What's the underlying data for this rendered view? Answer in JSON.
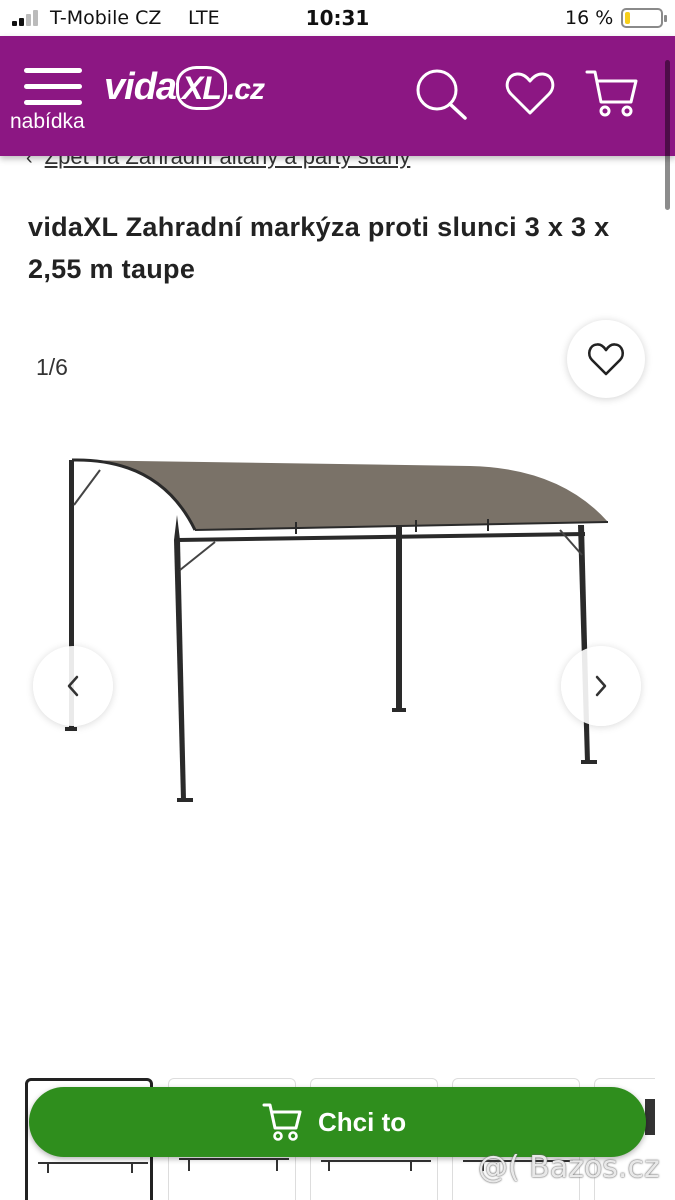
{
  "status_bar": {
    "carrier": "T-Mobile CZ",
    "network": "LTE",
    "time": "10:31",
    "battery_percent": "16 %",
    "battery_level": 0.16,
    "battery_color": "#f7cf1b"
  },
  "header": {
    "background_color": "#8c1783",
    "menu_label": "nabídka",
    "logo": {
      "part1": "vida",
      "part2": "XL",
      "part3": ".cz"
    },
    "icons": [
      "search-icon",
      "heart-icon",
      "cart-icon"
    ]
  },
  "breadcrumb": {
    "back_text": "Zpět na Zahradní altány a party stany"
  },
  "product": {
    "title": "vidaXL Zahradní markýza proti slunci 3 x 3 x 2,55 m taupe",
    "image_counter": "1/6",
    "canopy_color": "#7a7268",
    "thumbnail_count": 5
  },
  "cta": {
    "label": "Chci to",
    "color": "#2f8e1d"
  },
  "watermark": "@( Bazos.cz"
}
